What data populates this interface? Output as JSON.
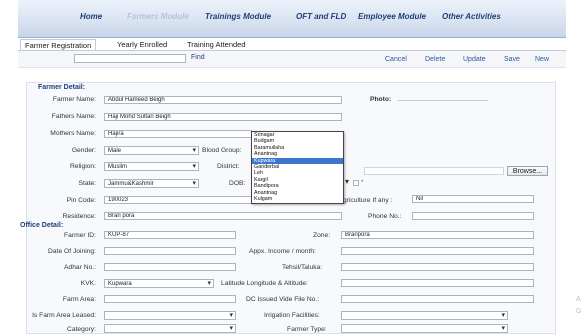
{
  "nav": {
    "items": [
      {
        "label": "Home",
        "dim": false
      },
      {
        "label": "Farmers Module",
        "dim": true
      },
      {
        "label": "Trainings Module",
        "dim": false
      },
      {
        "label": "OFT and FLD",
        "dim": false
      },
      {
        "label": "Employee Module",
        "dim": false
      },
      {
        "label": "Other Activities",
        "dim": false
      }
    ]
  },
  "tabs": [
    {
      "label": "Farmer Registration",
      "active": true
    },
    {
      "label": "Yearly Enrolled",
      "active": false
    },
    {
      "label": "Training Attended",
      "active": false
    }
  ],
  "toolbar": {
    "find_label": "Find",
    "cancel": "Cancel",
    "delete": "Delete",
    "update": "Update",
    "save": "Save",
    "new": "New"
  },
  "farmer": {
    "section": "Farmer Detail:",
    "farmer_name_label": "Farmer Name:",
    "farmer_name": "Abdul Hameed Beigh",
    "photo_label": "Photo:",
    "fathers_name_label": "Fathers Name:",
    "fathers_name": "Haji Mohd Sultan Beigh",
    "mothers_name_label": "Mothers Name:",
    "mothers_name": "Hajira",
    "gender_label": "Gender:",
    "gender": "Male",
    "blood_group_label": "Blood Group:",
    "religion_label": "Religion:",
    "religion": "Muslim",
    "district_label": "District:",
    "state_label": "State:",
    "state": "Jammu&Kashmir",
    "dob_label": "DOB:",
    "pin_label": "Pin Code:",
    "pin": "190023",
    "agri_label": "griculture If any :",
    "agri": "Nil",
    "residence_label": "Residence:",
    "residence": "Brari pora",
    "phone_label": "Phone No.:",
    "browse": "Browse..."
  },
  "district_dropdown": {
    "options": [
      "Srinagar",
      "Budgam",
      "Baramullaha",
      "Anantnag",
      "Kupwara",
      "Ganderbal",
      "Leh",
      "Kargil",
      "Bandipora",
      "Anantnag",
      "Kulgam"
    ],
    "selected_index": 4
  },
  "office": {
    "section": "Office Detail:",
    "farmer_id_label": "Farmer ID:",
    "farmer_id": "KUP-87",
    "zone_label": "Zone:",
    "zone": "Braripora",
    "doj_label": "Date Of Joining:",
    "income_label": "Appx. Income / month:",
    "adhar_label": "Adhar No.:",
    "tehsil_label": "Tehsil/Taluka:",
    "kvk_label": "KVK:",
    "kvk": "Kupwara",
    "latlong_label": "Latitude Longitude & Altitude:",
    "farm_area_label": "Farm Area:",
    "dc_label": "DC Issued Vide File No.:",
    "leased_label": "Is Farm Area Leased:",
    "irrigation_label": "Irrigation Facilities:",
    "category_label": "Category:",
    "farmer_type_label": "Farmer Type:"
  },
  "side_text": [
    "A",
    "G"
  ]
}
